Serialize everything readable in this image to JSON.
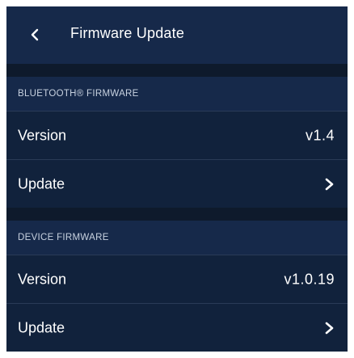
{
  "header": {
    "title": "Firmware Update",
    "back_icon": "chevron-left-icon"
  },
  "sections": [
    {
      "title": "BLUETOOTH® FIRMWARE",
      "version_label": "Version",
      "version_value": "v1.4",
      "update_label": "Update",
      "update_icon": "chevron-right-icon"
    },
    {
      "title": "DEVICE FIRMWARE",
      "version_label": "Version",
      "version_value": "v1.0.19",
      "update_label": "Update",
      "update_icon": "chevron-right-icon"
    }
  ],
  "colors": {
    "background": "#0e1a2c",
    "header": "#16294a",
    "row": "#11223c",
    "text": "#ffffff"
  }
}
